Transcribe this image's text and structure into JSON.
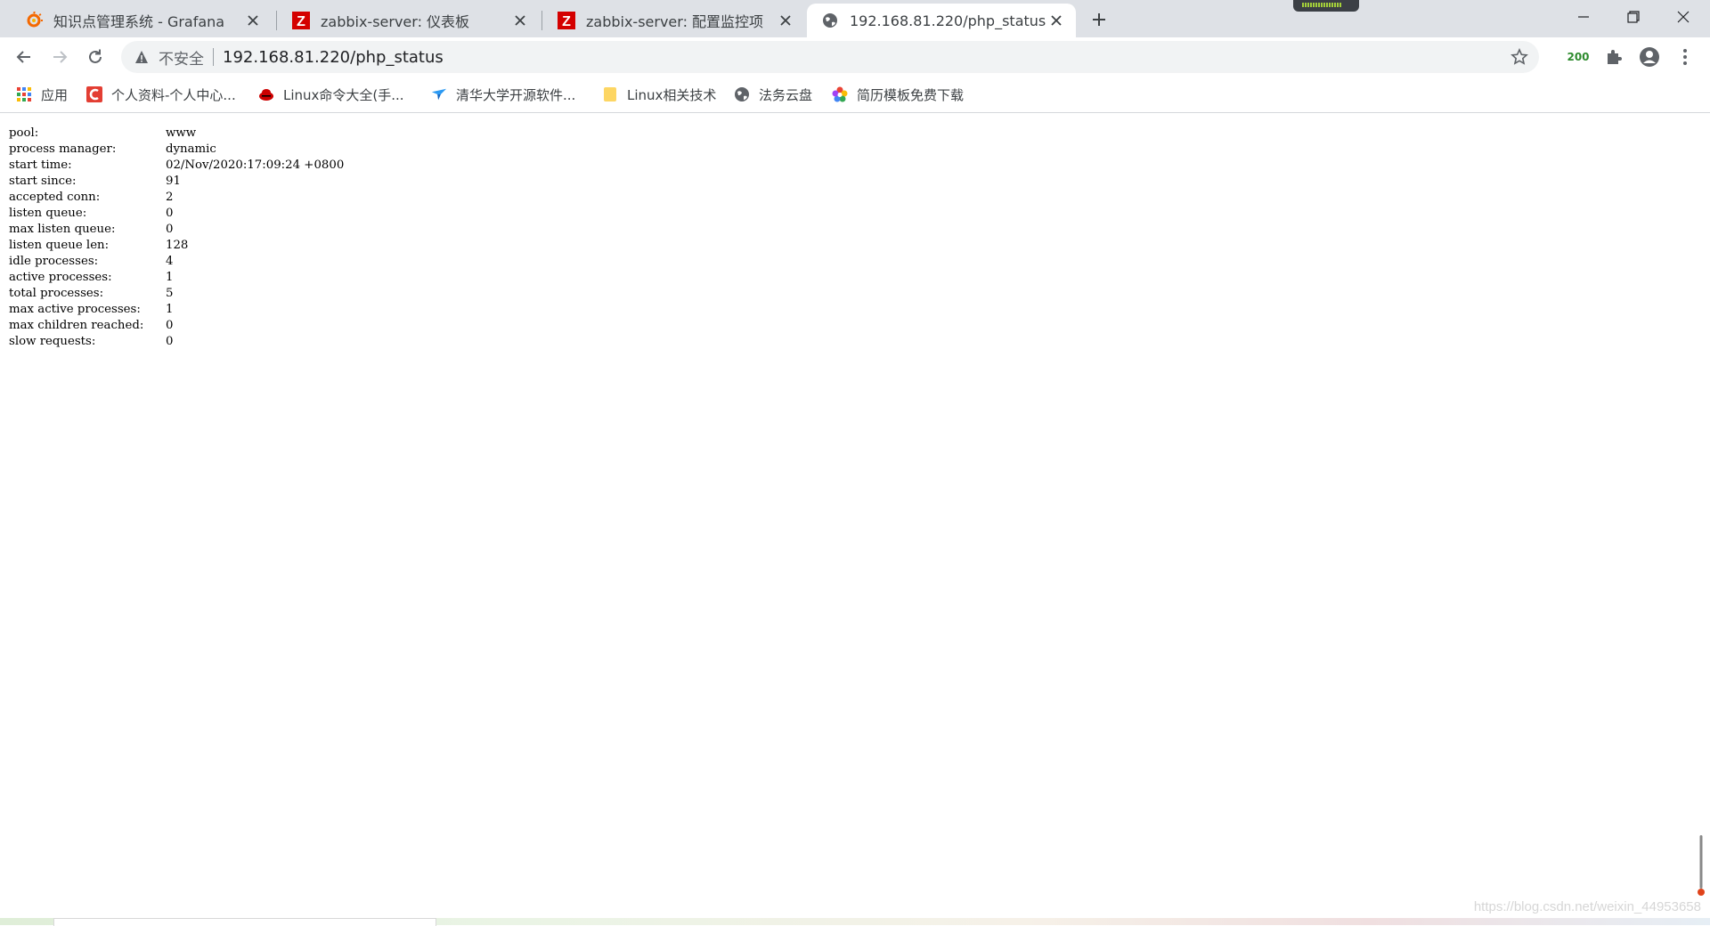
{
  "browser": {
    "tabs": [
      {
        "title": "知识点管理系统 - Grafana",
        "favicon": "grafana-icon",
        "active": false
      },
      {
        "title": "zabbix-server: 仪表板",
        "favicon": "zabbix-icon",
        "active": false
      },
      {
        "title": "zabbix-server: 配置监控项",
        "favicon": "zabbix-icon",
        "active": false
      },
      {
        "title": "192.168.81.220/php_status",
        "favicon": "globe-icon",
        "active": true
      }
    ],
    "omnibox": {
      "security_label": "不安全",
      "url": "192.168.81.220/php_status"
    },
    "extension_badge": "200",
    "colors": {
      "zabbix": "#d40000",
      "grafana": "#f46800",
      "tabstrip": "#dee1e6"
    }
  },
  "bookmarks": [
    {
      "label": "应用",
      "icon": "apps-grid-icon"
    },
    {
      "label": "个人资料-个人中心...",
      "icon": "csdn-icon"
    },
    {
      "label": "Linux命令大全(手...",
      "icon": "redhat-icon"
    },
    {
      "label": "清华大学开源软件...",
      "icon": "tuna-bird-icon"
    },
    {
      "label": "Linux相关技术",
      "icon": "folder-icon"
    },
    {
      "label": "法务云盘",
      "icon": "globe-icon"
    },
    {
      "label": "简历模板免费下载",
      "icon": "flower-icon"
    }
  ],
  "status": [
    {
      "key": "pool:",
      "value": "www"
    },
    {
      "key": "process manager:",
      "value": "dynamic"
    },
    {
      "key": "start time:",
      "value": "02/Nov/2020:17:09:24 +0800"
    },
    {
      "key": "start since:",
      "value": "91"
    },
    {
      "key": "accepted conn:",
      "value": "2"
    },
    {
      "key": "listen queue:",
      "value": "0"
    },
    {
      "key": "max listen queue:",
      "value": "0"
    },
    {
      "key": "listen queue len:",
      "value": "128"
    },
    {
      "key": "idle processes:",
      "value": "4"
    },
    {
      "key": "active processes:",
      "value": "1"
    },
    {
      "key": "total processes:",
      "value": "5"
    },
    {
      "key": "max active processes:",
      "value": "1"
    },
    {
      "key": "max children reached:",
      "value": "0"
    },
    {
      "key": "slow requests:",
      "value": "0"
    }
  ],
  "watermark": "https://blog.csdn.net/weixin_44953658"
}
